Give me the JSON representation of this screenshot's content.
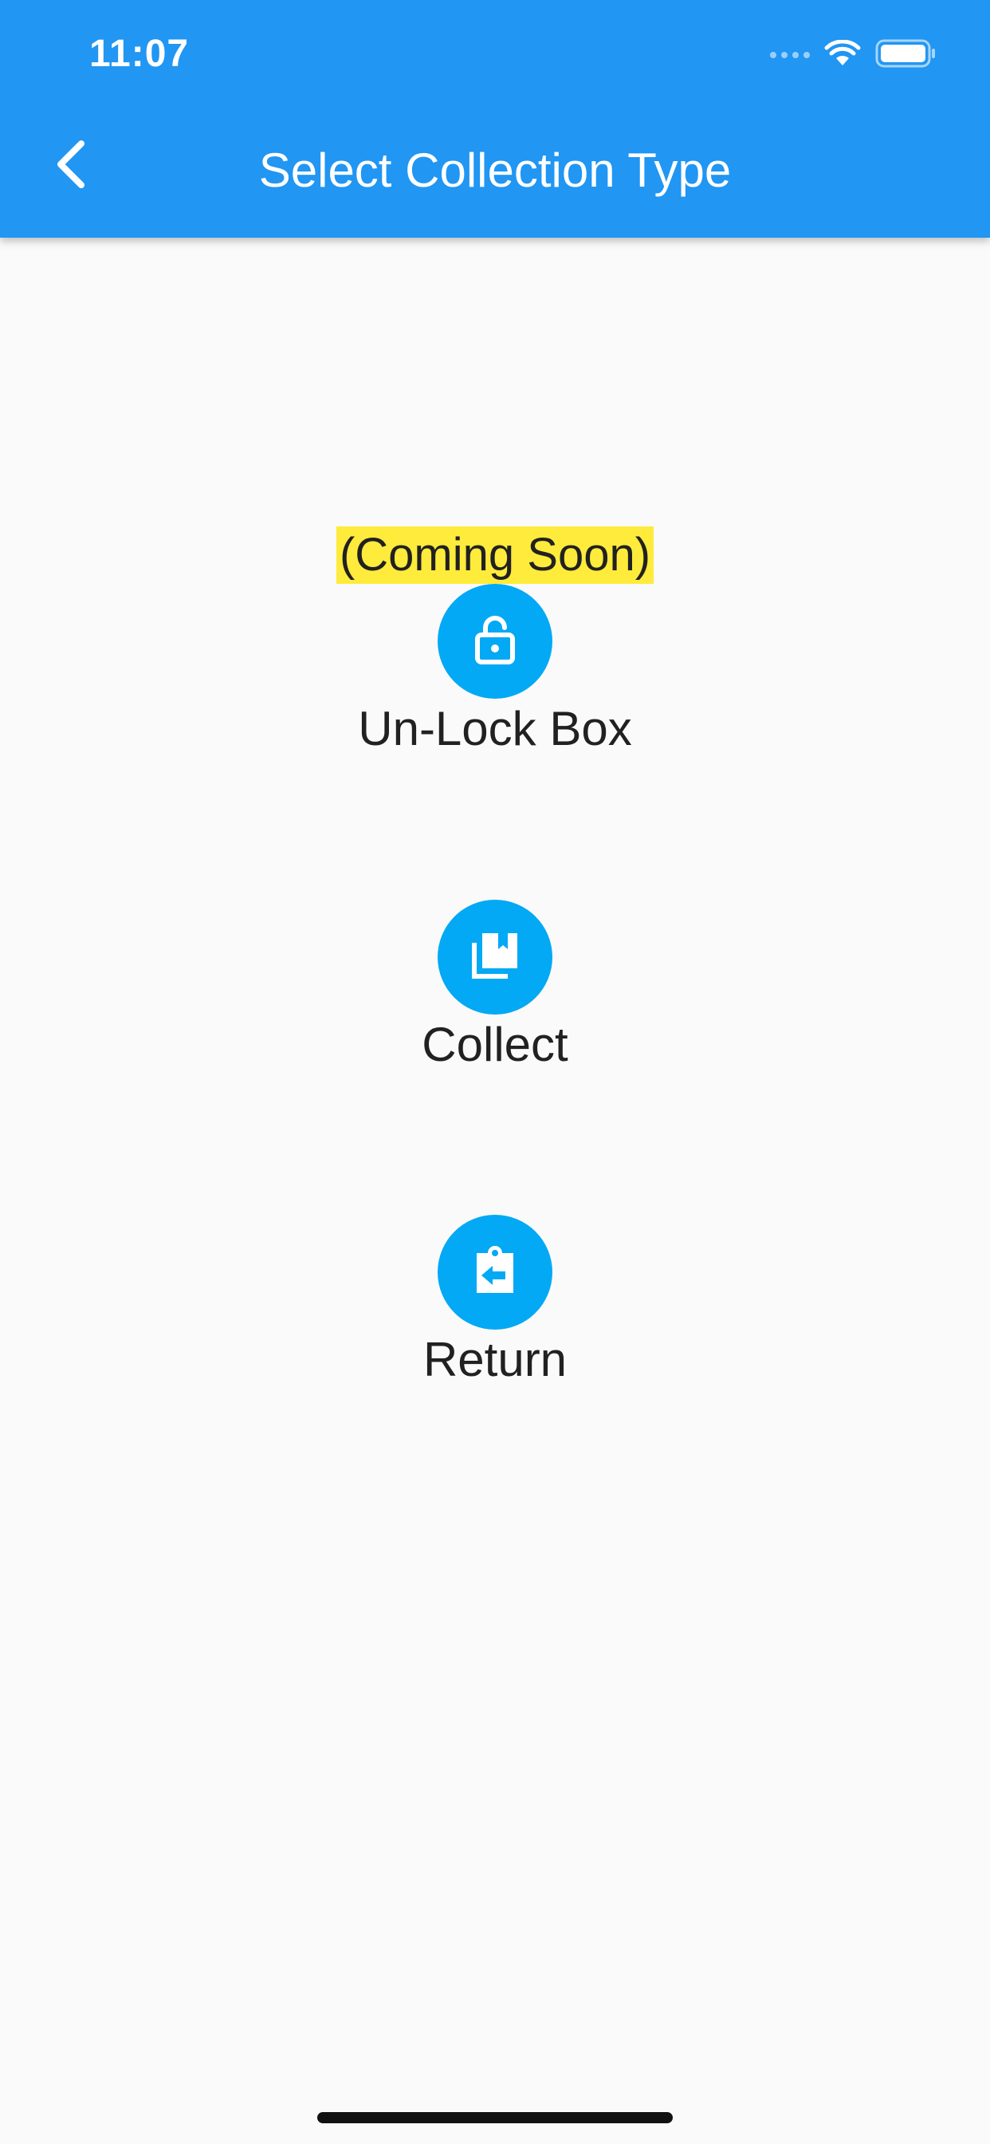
{
  "status_bar": {
    "time": "11:07",
    "wifi_icon": "wifi-icon",
    "battery_icon": "battery-icon"
  },
  "header": {
    "title": "Select Collection Type",
    "back_icon": "chevron-left-icon"
  },
  "badge": {
    "coming_soon": "(Coming Soon)"
  },
  "options": [
    {
      "label": "Un-Lock Box",
      "icon": "unlock-icon"
    },
    {
      "label": "Collect",
      "icon": "library-books-icon"
    },
    {
      "label": "Return",
      "icon": "assignment-return-icon"
    }
  ],
  "colors": {
    "app_bar": "#2196F3",
    "option_circle": "#03A9F4",
    "badge_bg": "#FFEB3B",
    "background": "#FAFAFA"
  }
}
